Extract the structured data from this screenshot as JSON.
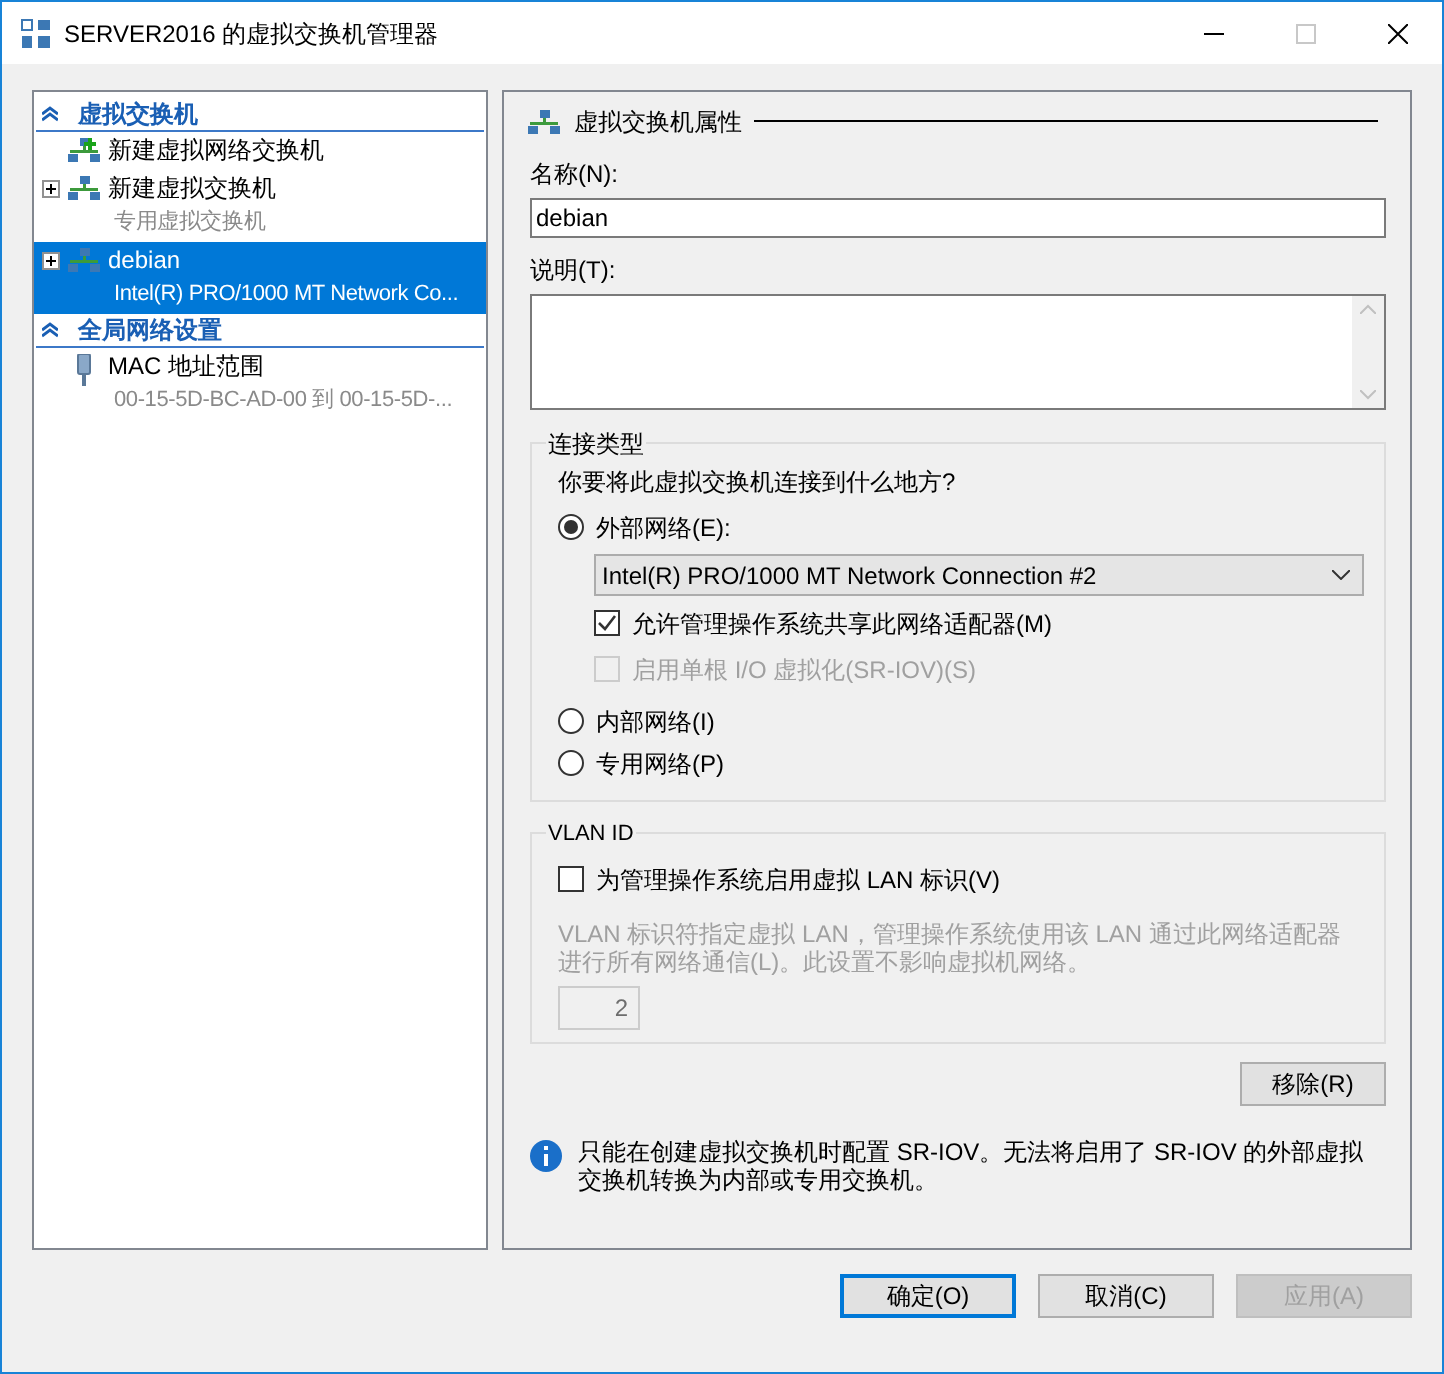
{
  "window": {
    "title": "SERVER2016 的虚拟交换机管理器"
  },
  "tree": [
    {
      "label": "虚拟交换机",
      "expanded": true,
      "items": [
        {
          "kind": "add",
          "title": "新建虚拟网络交换机",
          "selected": false
        },
        {
          "kind": "switch",
          "title": "新建虚拟交换机",
          "subtitle": "专用虚拟交换机",
          "selected": false
        },
        {
          "kind": "switch",
          "title": "debian",
          "subtitle": "Intel(R) PRO/1000 MT Network Co...",
          "selected": true
        }
      ]
    },
    {
      "label": "全局网络设置",
      "expanded": true,
      "items": [
        {
          "kind": "mac",
          "title": "MAC 地址范围",
          "subtitle": "00-15-5D-BC-AD-00 到 00-15-5D-...",
          "selected": false
        }
      ]
    }
  ],
  "properties": {
    "heading": "虚拟交换机属性",
    "name_label": "名称(N):",
    "name_value": "debian",
    "description_label": "说明(T):"
  },
  "connection": {
    "title": "连接类型",
    "question": "你要将此虚拟交换机连接到什么地方?",
    "options": [
      {
        "label": "外部网络(E):",
        "selected": true
      },
      {
        "label": "内部网络(I)",
        "selected": false
      },
      {
        "label": "专用网络(P)",
        "selected": false
      }
    ],
    "adapter": "Intel(R) PRO/1000 MT Network Connection #2",
    "checkboxes": [
      {
        "label": "允许管理操作系统共享此网络适配器(M)",
        "checked": true,
        "disabled": false
      },
      {
        "label": "启用单根 I/O 虚拟化(SR-IOV)(S)",
        "checked": false,
        "disabled": true
      }
    ]
  },
  "vlan": {
    "title": "VLAN ID",
    "checkbox": {
      "label": "为管理操作系统启用虚拟 LAN 标识(V)",
      "checked": false,
      "disabled": false
    },
    "description": "VLAN 标识符指定虚拟 LAN，管理操作系统使用该 LAN 通过此网络适配器进行所有网络通信(L)。此设置不影响虚拟机网络。",
    "value": "2",
    "disabled": true
  },
  "remove_button": "移除(R)",
  "info": "只能在创建虚拟交换机时配置 SR-IOV。无法将启用了 SR-IOV 的外部虚拟交换机转换为内部或专用交换机。",
  "buttons": [
    {
      "label": "确定(O)",
      "default": true,
      "disabled": false
    },
    {
      "label": "取消(C)",
      "default": false,
      "disabled": false
    },
    {
      "label": "应用(A)",
      "default": false,
      "disabled": true
    }
  ]
}
